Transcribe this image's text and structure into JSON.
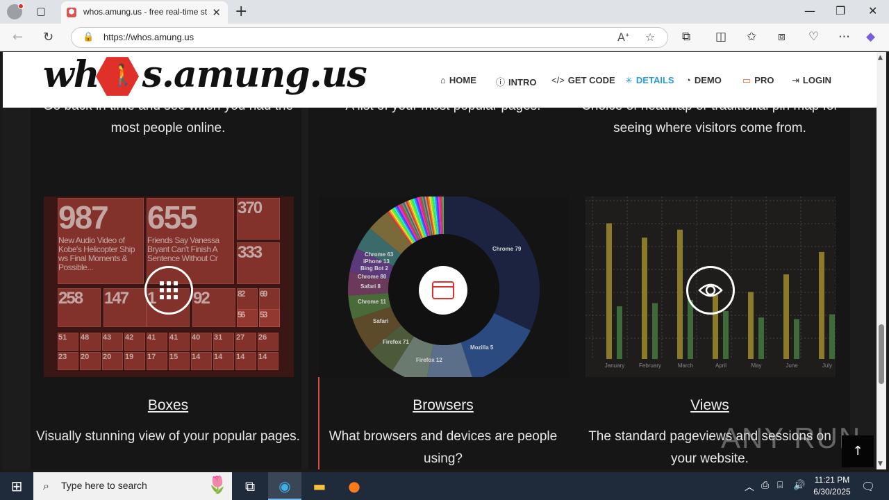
{
  "browser": {
    "tab_title": "whos.amung.us - free real-time st",
    "tab_favicon": "whos-amung-us-favicon",
    "url": "https://whos.amung.us",
    "new_tab_icon": "+",
    "close_icon": "✕"
  },
  "site": {
    "logo_left": "wh",
    "logo_right": "s.amung.us",
    "nav": [
      {
        "label": "HOME",
        "icon": "home-icon"
      },
      {
        "label": "INTRO",
        "icon": "info-icon"
      },
      {
        "label": "GET CODE",
        "icon": "code-icon"
      },
      {
        "label": "DETAILS",
        "icon": "asterisk-icon"
      },
      {
        "label": "DEMO",
        "icon": "dashboard-icon"
      },
      {
        "label": "PRO",
        "icon": "pro-icon"
      },
      {
        "label": "LOGIN",
        "icon": "login-icon"
      }
    ],
    "active_nav": "DETAILS",
    "accent_color": "#2b9bd6"
  },
  "intro_texts": {
    "col1": "Go back in time and see when you had the most people online.",
    "col2": "A list of your most popular pages.",
    "col3": "Choice of heatmap or traditional pin map for seeing where visitors come from."
  },
  "boxes_thumb": {
    "big": [
      {
        "n": "987",
        "t": "New Audio Video of Kobe's Helicopter Ship ws Final Moments & Possible..."
      },
      {
        "n": "655",
        "t": "Friends Say Vanessa Bryant Can't Finish A Sentence Without Cr"
      },
      {
        "n": "370",
        "t": ""
      },
      {
        "n": "333",
        "t": ""
      }
    ],
    "mid": [
      "258",
      "147",
      "1",
      "92",
      "82",
      "69",
      "56",
      "53"
    ],
    "small": [
      "51",
      "48",
      "43",
      "42",
      "41",
      "41",
      "40",
      "31",
      "27",
      "26",
      "23",
      "20",
      "20",
      "19",
      "17",
      "15",
      "14",
      "14",
      "14",
      "14"
    ]
  },
  "browsers_thumb": {
    "labels": [
      "Chrome 79",
      "Chrome 63",
      "iPhone 13",
      "Bing Bot 2",
      "Chrome 80",
      "Safari 8",
      "Chrome 11",
      "Safari",
      "Firefox 71",
      "Firefox 12",
      "Mozilla 5"
    ]
  },
  "views_thumb": {
    "months": [
      "January",
      "February",
      "March",
      "April",
      "May",
      "June",
      "July"
    ],
    "pageviews": [
      0.85,
      0.76,
      0.81,
      0.4,
      0.42,
      0.53,
      0.67
    ],
    "sessions": [
      0.33,
      0.35,
      0.37,
      0.3,
      0.26,
      0.25,
      0.28
    ],
    "pageview_color": "#8a7a2a",
    "session_color": "#3f6b3a"
  },
  "cards": [
    {
      "title": "Boxes",
      "desc": "Visually stunning view of your popular pages.",
      "icon": "grid-icon"
    },
    {
      "title": "Browsers",
      "desc": "What browsers and devices are people using?",
      "icon": "browser-window-icon"
    },
    {
      "title": "Views",
      "desc": "The standard pageviews and sessions on your website.",
      "icon": "eye-icon"
    }
  ],
  "watermark": "ANY RUN",
  "to_top_icon": "↑",
  "taskbar": {
    "search_placeholder": "Type here to search",
    "time": "11:21 PM",
    "date": "6/30/2025"
  }
}
